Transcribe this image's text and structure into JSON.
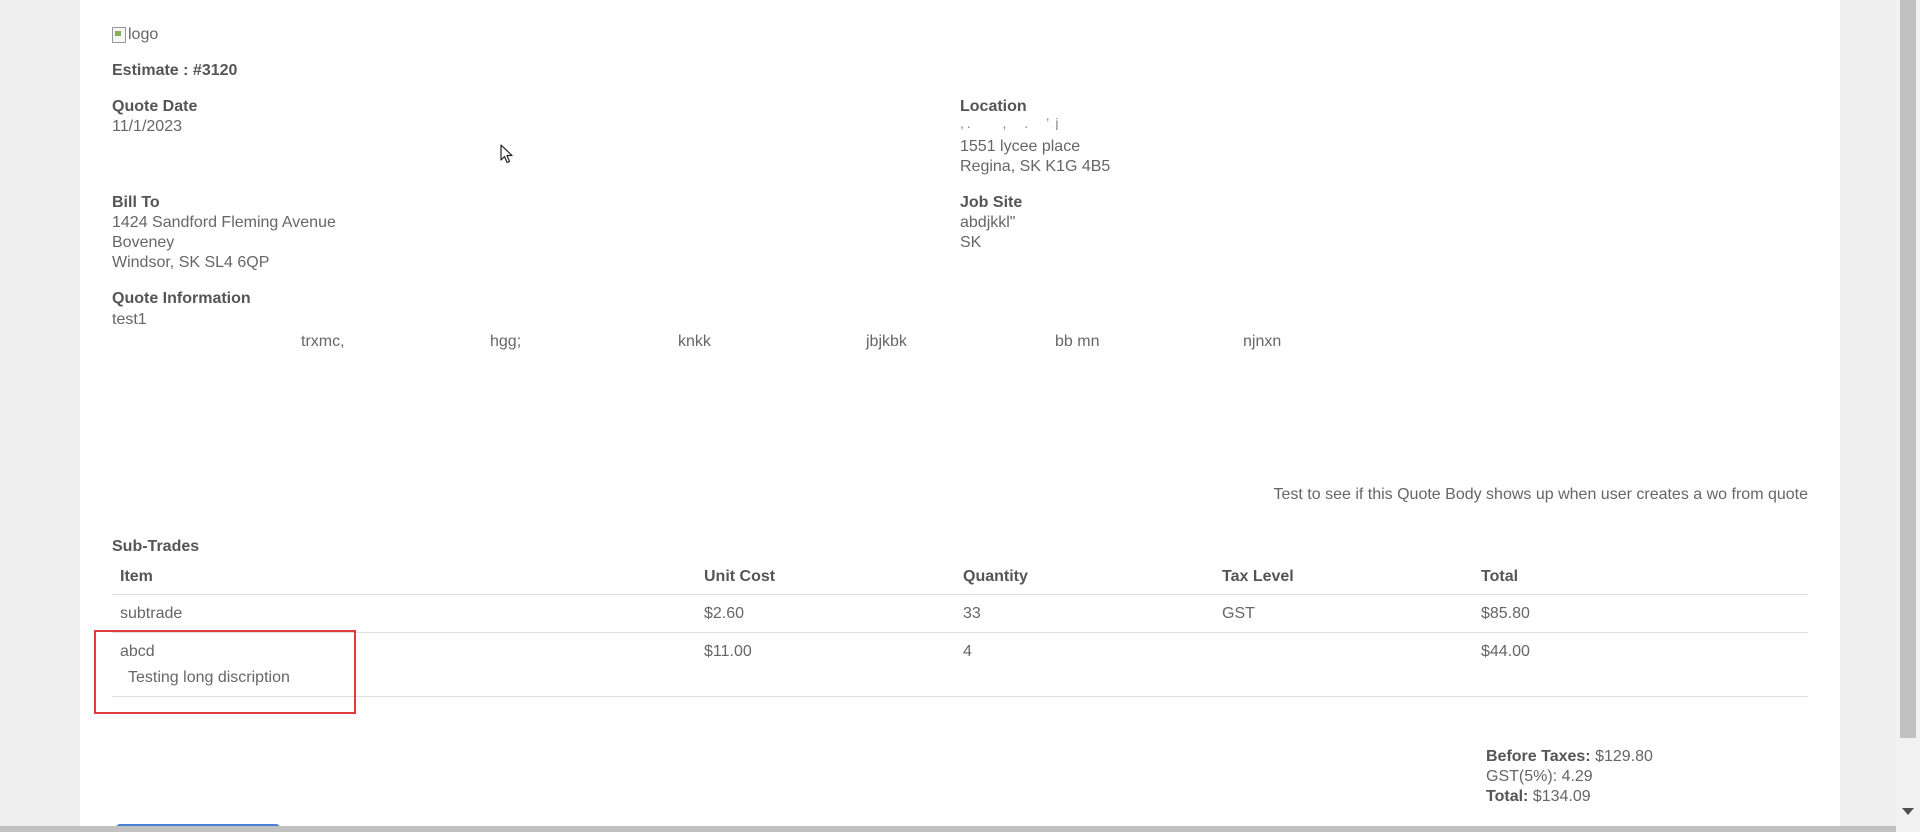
{
  "logo": {
    "alt": "logo"
  },
  "estimate": {
    "label": "Estimate : #3120"
  },
  "quote_date": {
    "label": "Quote Date",
    "value": "11/1/2023"
  },
  "location": {
    "label": "Location",
    "line1_obscured": ", .           ,      .      ’  j",
    "line2": "1551 lycee place",
    "line3": "Regina, SK K1G 4B5"
  },
  "bill_to": {
    "label": "Bill To",
    "line1": "1424 Sandford Fleming Avenue",
    "line2": "Boveney",
    "line3": "Windsor, SK SL4 6QP"
  },
  "job_site": {
    "label": "Job Site",
    "line1": "abdjkkl\"",
    "line2": "SK"
  },
  "quote_info": {
    "label": "Quote Information",
    "value": "test1",
    "columns": [
      "trxmc,",
      "hgg;",
      "knkk",
      "jbjkbk",
      "bb mn",
      "njnxn"
    ]
  },
  "quote_body": "Test to see if this Quote Body shows up when user creates a wo from quote",
  "sub_trades": {
    "label": "Sub-Trades",
    "headers": {
      "item": "Item",
      "unit_cost": "Unit Cost",
      "quantity": "Quantity",
      "tax_level": "Tax Level",
      "total": "Total"
    },
    "rows": [
      {
        "item": "subtrade",
        "description": "",
        "unit_cost": "$2.60",
        "quantity": "33",
        "tax_level": "GST",
        "total": "$85.80"
      },
      {
        "item": "abcd",
        "description": "Testing long discription",
        "unit_cost": "$11.00",
        "quantity": "4",
        "tax_level": "",
        "total": "$44.00"
      }
    ]
  },
  "totals": {
    "before_taxes_label": "Before Taxes:",
    "before_taxes_value": "$129.80",
    "gst": "GST(5%): 4.29",
    "total_label": "Total:",
    "total_value": "$134.09"
  },
  "colors": {
    "highlight": "#e03c3c",
    "text": "#666666",
    "heading": "#555555"
  }
}
